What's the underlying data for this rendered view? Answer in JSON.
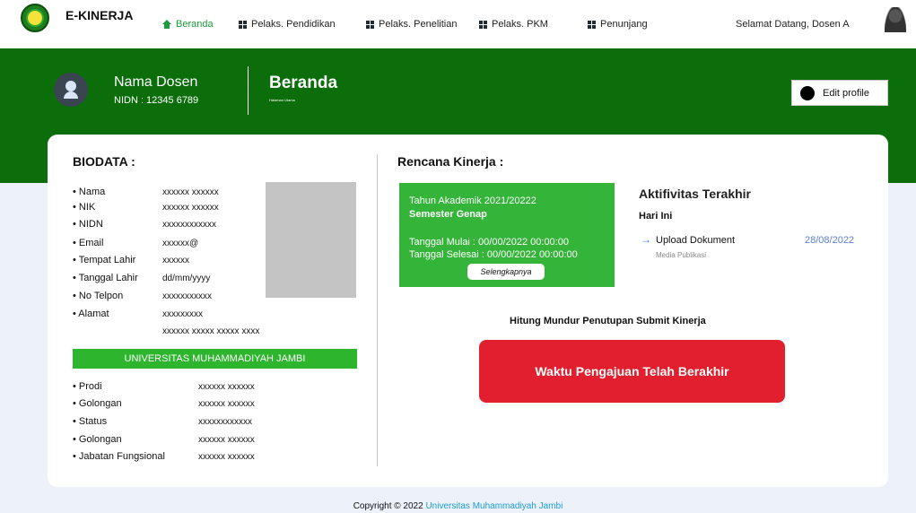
{
  "navbar": {
    "brand": "E-KINERJA",
    "items": [
      {
        "label": "Beranda",
        "icon": "home-icon",
        "active": true
      },
      {
        "label": "Pelaks. Pendidikan",
        "icon": "grid-icon"
      },
      {
        "label": "Pelaks. Penelitian",
        "icon": "grid-icon"
      },
      {
        "label": "Pelaks. PKM",
        "icon": "grid-icon"
      },
      {
        "label": "Penunjang",
        "icon": "grid-icon"
      }
    ],
    "welcome": "Selamat Datang, Dosen A"
  },
  "banner": {
    "name": "Nama Dosen",
    "nidn": "NIDN : 12345 6789",
    "page_title": "Beranda",
    "page_subtitle": "Halaman Utama",
    "edit_label": "Edit profile"
  },
  "biodata": {
    "title": "BIODATA :",
    "rows": [
      {
        "label": "• Nama",
        "value": "xxxxxx xxxxxx"
      },
      {
        "label": "• NIK",
        "value": "xxxxxx xxxxxx"
      },
      {
        "label": "• NIDN",
        "value": "xxxxxxxxxxxx"
      },
      {
        "label": "• Email",
        "value": "xxxxxx@"
      },
      {
        "label": "• Tempat Lahir",
        "value": "xxxxxx"
      },
      {
        "label": "• Tanggal Lahir",
        "value": "dd/mm/yyyy"
      },
      {
        "label": "• No Telpon",
        "value": "xxxxxxxxxxx"
      },
      {
        "label": "• Alamat",
        "value": "xxxxxxxxx"
      }
    ],
    "address_line2": "xxxxxx xxxxx xxxxx xxxx",
    "university": "UNIVERSITAS MUHAMMADIYAH JAMBI",
    "rows2": [
      {
        "label": "• Prodi",
        "value": "xxxxxx xxxxxx"
      },
      {
        "label": "• Golongan",
        "value": "xxxxxx xxxxxx"
      },
      {
        "label": "• Status",
        "value": "xxxxxxxxxxxx"
      },
      {
        "label": "• Golongan",
        "value": "xxxxxx xxxxxx"
      },
      {
        "label": "• Jabatan Fungsional",
        "value": "xxxxxx xxxxxx"
      }
    ]
  },
  "rencana": {
    "title": "Rencana Kinerja :",
    "tahun": "Tahun Akademik 2021/20222",
    "semester": "Semester Genap",
    "mulai": "Tanggal Mulai    : 00/00/2022 00:00:00",
    "selesai": "Tanggal Selesai : 00/00/2022 00:00:00",
    "more_label": "Selengkapnya"
  },
  "aktifitas": {
    "title": "Aktifivitas Terakhir",
    "today": "Hari Ini",
    "item": "Upload Dokument",
    "item_sub": "Media Publikasi",
    "date": "28/08/2022"
  },
  "countdown": {
    "title": "Hitung Mundur Penutupan Submit Kinerja",
    "message": "Waktu Pengajuan Telah Berakhir"
  },
  "footer": {
    "text": "Copyright © 2022 ",
    "link": "Universitas Muhammadiyah Jambi"
  },
  "colors": {
    "banner": "#0b6e0b",
    "accent_green": "#34b53a",
    "alert_red": "#e11f2e",
    "link_blue": "#1a9ed6"
  }
}
